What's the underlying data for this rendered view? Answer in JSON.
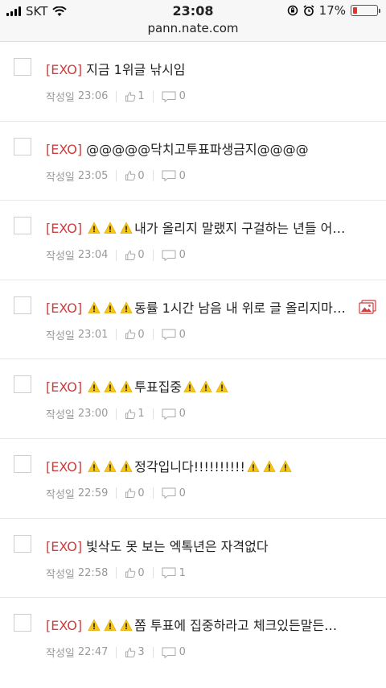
{
  "status_bar": {
    "carrier": "SKT",
    "time": "23:08",
    "battery_percent": "17%",
    "battery_level": 0.17
  },
  "browser": {
    "url": "pann.nate.com"
  },
  "colors": {
    "tag": "#d23c3c",
    "battery": "#e5332a",
    "meta": "#999999"
  },
  "posts": [
    {
      "tag": "[EXO]",
      "warn_before": 0,
      "title": "지금 1위글 낚시임",
      "warn_after": 0,
      "author": "작성일",
      "time": "23:06",
      "likes": "1",
      "comments": "0",
      "has_photo": false
    },
    {
      "tag": "[EXO]",
      "warn_before": 0,
      "title": "@@@@@닥치고투표파생금지@@@@",
      "warn_after": 0,
      "author": "작성일",
      "time": "23:05",
      "likes": "0",
      "comments": "0",
      "has_photo": false
    },
    {
      "tag": "[EXO]",
      "warn_before": 3,
      "title": "내가 올리지 말랬지 구걸하는 년들 어…",
      "warn_after": 0,
      "author": "작성일",
      "time": "23:04",
      "likes": "0",
      "comments": "0",
      "has_photo": false
    },
    {
      "tag": "[EXO]",
      "warn_before": 3,
      "title": "동률 1시간 남음 내 위로 글 올리지마…",
      "warn_after": 0,
      "author": "작성일",
      "time": "23:01",
      "likes": "0",
      "comments": "0",
      "has_photo": true
    },
    {
      "tag": "[EXO]",
      "warn_before": 3,
      "title": "투표집중",
      "warn_after": 3,
      "author": "작성일",
      "time": "23:00",
      "likes": "1",
      "comments": "0",
      "has_photo": false
    },
    {
      "tag": "[EXO]",
      "warn_before": 3,
      "title": "정각입니다!!!!!!!!!!",
      "warn_after": 3,
      "author": "작성일",
      "time": "22:59",
      "likes": "0",
      "comments": "0",
      "has_photo": false
    },
    {
      "tag": "[EXO]",
      "warn_before": 0,
      "title": "빛삭도 못 보는 엑톡년은 자격없다",
      "warn_after": 0,
      "author": "작성일",
      "time": "22:58",
      "likes": "0",
      "comments": "1",
      "has_photo": false
    },
    {
      "tag": "[EXO]",
      "warn_before": 3,
      "title": "쫌 투표에 집중하라고 체크있든말든…",
      "warn_after": 0,
      "author": "작성일",
      "time": "22:47",
      "likes": "3",
      "comments": "0",
      "has_photo": false
    }
  ]
}
